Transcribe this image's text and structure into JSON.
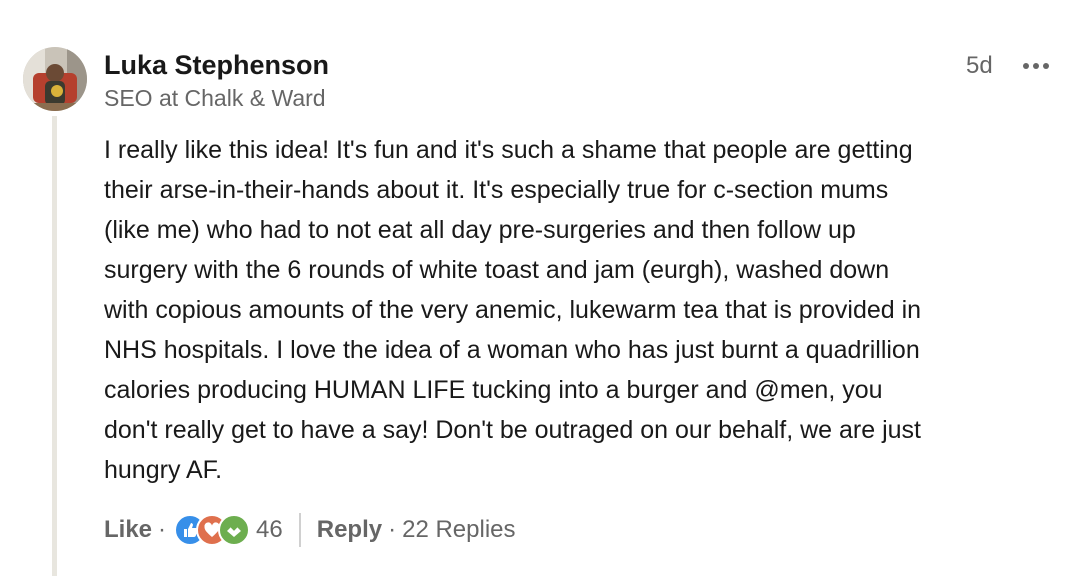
{
  "comment": {
    "author": {
      "name": "Luka Stephenson",
      "headline": "SEO at Chalk & Ward"
    },
    "timestamp": "5d",
    "more_icon": "more-horizontal-icon",
    "body_lines": [
      "I really like this idea! It's fun and it's such a shame that people are getting",
      "their arse-in-their-hands about it. It's especially true for c-section mums",
      "(like me) who had to not eat all day pre-surgeries and then follow up",
      "surgery with the 6 rounds of white toast and jam (eurgh), washed down",
      "with copious amounts of the very anemic, lukewarm tea that is provided in",
      "NHS hospitals. I love the idea of a woman who has just burnt a quadrillion",
      "calories producing HUMAN LIFE tucking into a burger and @men, you",
      "don't really get to have a say! Don't be outraged on our behalf, we are just",
      "hungry AF."
    ]
  },
  "actions": {
    "like_label": "Like",
    "separator": "·",
    "reaction_icons": [
      "like-reaction-icon",
      "love-reaction-icon",
      "support-reaction-icon"
    ],
    "reaction_count": "46",
    "reply_label": "Reply",
    "replies_label": "22 Replies"
  },
  "colors": {
    "text_primary": "#191919",
    "text_secondary": "#666666",
    "like_blue": "#378fe9",
    "love_red": "#df704d",
    "support_green": "#6dae4f",
    "thread_line": "#e8e6df"
  }
}
